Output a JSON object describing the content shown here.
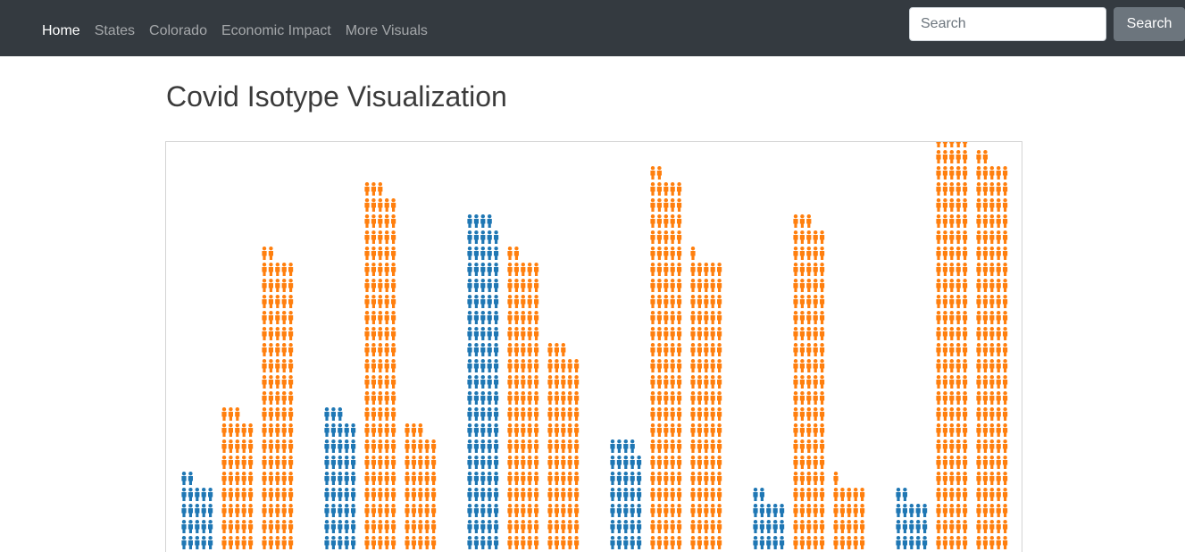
{
  "navbar": {
    "links": [
      {
        "label": "Home",
        "active": true
      },
      {
        "label": "States",
        "active": false
      },
      {
        "label": "Colorado",
        "active": false
      },
      {
        "label": "Economic Impact",
        "active": false
      },
      {
        "label": "More Visuals",
        "active": false
      }
    ],
    "search": {
      "placeholder": "Search",
      "button_label": "Search"
    }
  },
  "page": {
    "title": "Covid Isotype Visualization"
  },
  "chart_data": {
    "type": "bar",
    "style": "isotype",
    "grid": false,
    "groups": 6,
    "bar_color_sequence": [
      "blue",
      "orange",
      "orange"
    ],
    "colors": {
      "blue": "#1f77b4",
      "orange": "#ff7f0e"
    },
    "icons_per_bar": [
      [
        22,
        43,
        92
      ],
      [
        43,
        113,
        38
      ],
      [
        104,
        92,
        63
      ],
      [
        34,
        117,
        91
      ],
      [
        17,
        103,
        21
      ],
      [
        17,
        136,
        122
      ]
    ]
  }
}
